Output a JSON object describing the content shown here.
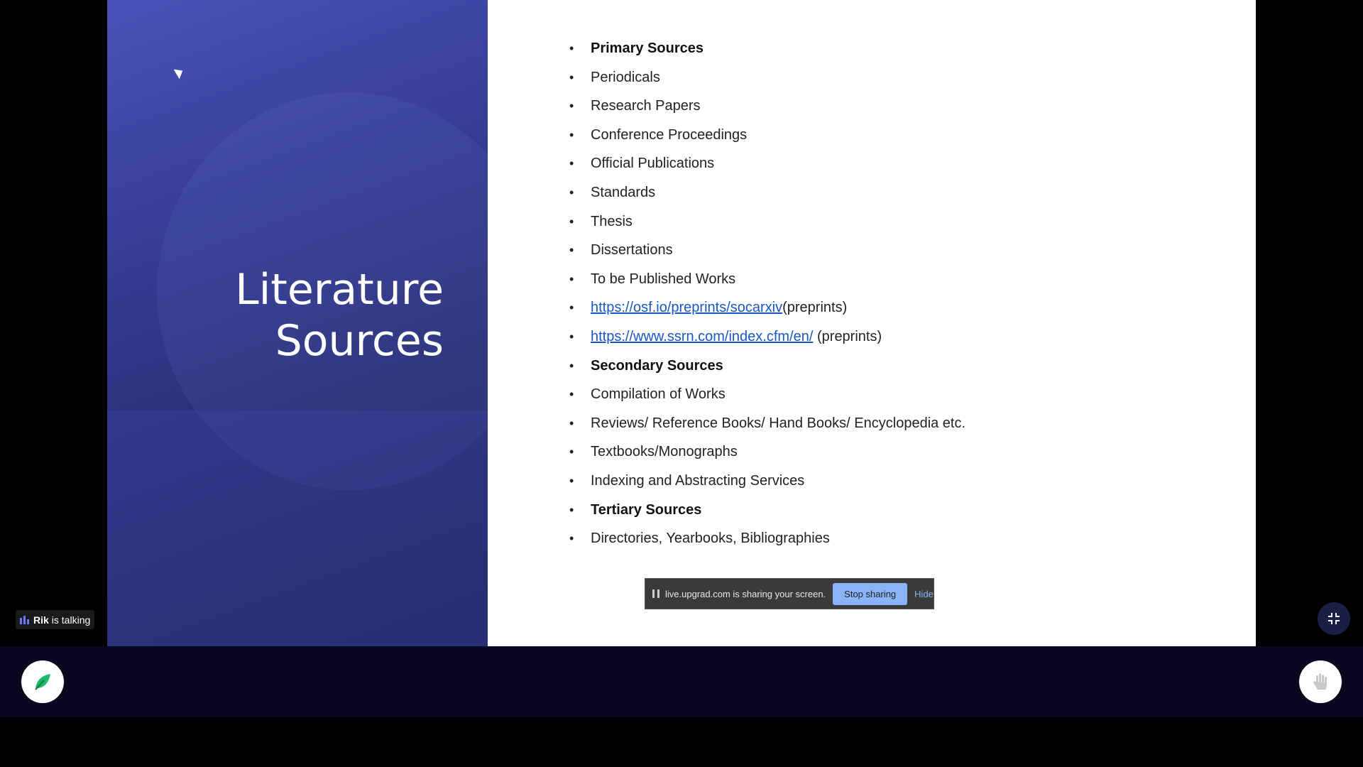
{
  "slide": {
    "title_line1": "Literature",
    "title_line2": "Sources",
    "bullets": [
      {
        "text": "Primary Sources",
        "bold": true
      },
      {
        "text": "Periodicals"
      },
      {
        "text": "Research Papers"
      },
      {
        "text": "Conference Proceedings"
      },
      {
        "text": "Official Publications"
      },
      {
        "text": "Standards"
      },
      {
        "text": "Thesis"
      },
      {
        "text": "Dissertations"
      },
      {
        "text": "To be Published Works"
      },
      {
        "link": "https://osf.io/preprints/socarxiv",
        "suffix": "(preprints)"
      },
      {
        "link": "https://www.ssrn.com/index.cfm/en/",
        "suffix": " (preprints)"
      },
      {
        "text": "Secondary Sources",
        "bold": true
      },
      {
        "text": "Compilation of Works"
      },
      {
        "text": "Reviews/ Reference Books/ Hand Books/ Encyclopedia etc."
      },
      {
        "text": "Textbooks/Monographs"
      },
      {
        "text": "Indexing and Abstracting Services"
      },
      {
        "text": "Tertiary Sources",
        "bold": true
      },
      {
        "text": "Directories, Yearbooks, Bibliographies"
      }
    ]
  },
  "share_bar": {
    "message": "live.upgrad.com is sharing your screen.",
    "stop_label": "Stop sharing",
    "hide_label": "Hide"
  },
  "talking": {
    "name": "Rik",
    "suffix": "is talking"
  },
  "icons": {
    "exit_fullscreen": "exit-fullscreen-icon",
    "logo": "leaf-logo-icon",
    "raise_hand": "raise-hand-icon"
  },
  "colors": {
    "accent": "#6c79ff",
    "logo_green": "#1fb86a",
    "link": "#1a56c4"
  }
}
